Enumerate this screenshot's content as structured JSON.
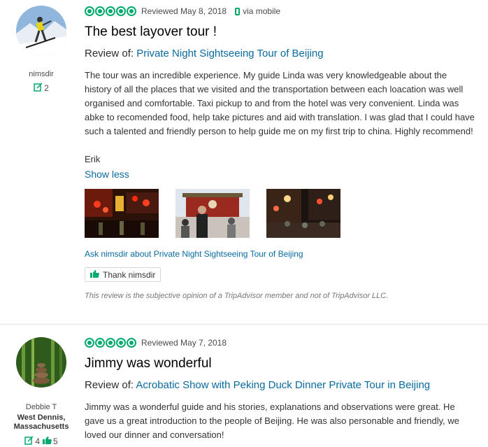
{
  "reviews": [
    {
      "username": "nimsdir",
      "contributions": "2",
      "location": "",
      "helpful_votes": "",
      "rating": 5,
      "reviewed_date": "Reviewed May 8, 2018",
      "via": "via mobile",
      "title": "The best layover tour !",
      "review_of_label": "Review of: ",
      "product": "Private Night Sightseeing Tour of Beijing",
      "body": "The tour was an incredible experience. My guide Linda was very knowledgeable about the history of all the places that we visited and the transportation between each loacation was well organised and comfortable. Taxi pickup to and from the hotel was very convenient. Linda was abke to recomended food, help take pictures and aid with translation. I was glad that I could have such a talented and friendly person to help guide me on my first trip to china. Highly recommend!",
      "signature": "Erik",
      "show_less": "Show less",
      "ask_link": "Ask nimsdir about Private Night Sightseeing Tour of Beijing",
      "thank_label": "Thank nimsdir",
      "disclaimer": "This review is the subjective opinion of a TripAdvisor member and not of TripAdvisor LLC."
    },
    {
      "username": "Debbie T",
      "location": "West Dennis, Massachusetts",
      "contributions": "4",
      "helpful_votes": "5",
      "rating": 5,
      "reviewed_date": "Reviewed May 7, 2018",
      "title": "Jimmy was wonderful",
      "review_of_label": "Review of: ",
      "product": "Acrobatic Show with Peking Duck Dinner Private Tour in Beijing",
      "body": "Jimmy was a wonderful guide and his stories, explanations and observations were great. He gave us a great introduction to the people of Beijing. He was also personable and friendly, we loved our dinner and conversation!"
    }
  ],
  "icons": {
    "rating": "bubble-icon",
    "mobile": "phone-icon",
    "contributions": "review-count-icon",
    "helpful": "thumbs-up-icon"
  },
  "colors": {
    "accent_green": "#00aa6c",
    "link_blue": "#0a6a9f"
  }
}
